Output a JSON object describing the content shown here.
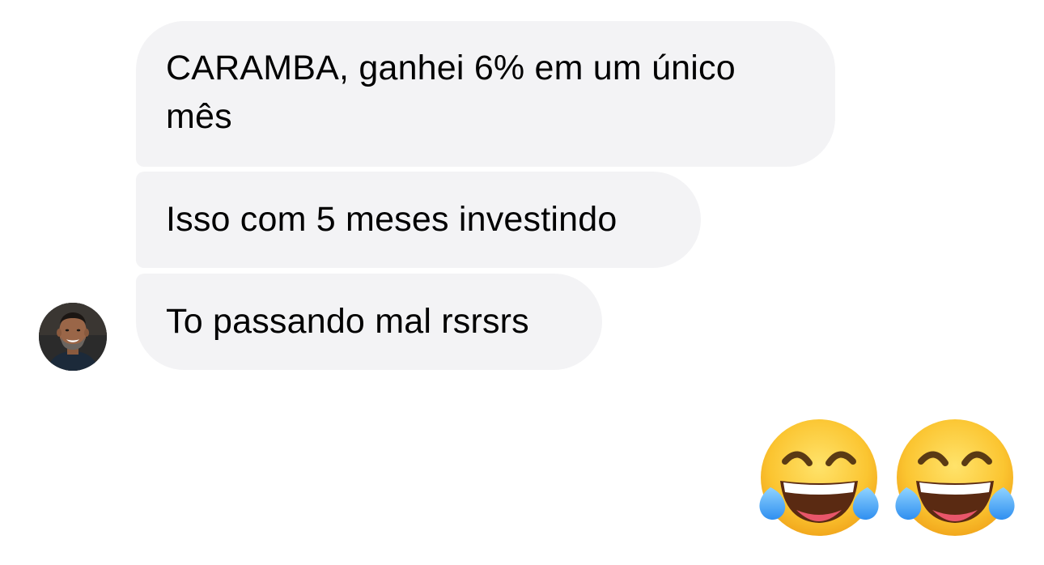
{
  "conversation": {
    "incoming_messages": [
      {
        "text": "CARAMBA, ganhei 6% em um único mês"
      },
      {
        "text": "Isso com 5 meses investindo"
      },
      {
        "text": "To passando mal rsrsrs"
      }
    ],
    "sender": {
      "avatar_icon": "person-photo-avatar"
    },
    "outgoing_emoji": [
      {
        "icon": "face-with-tears-of-joy-icon"
      },
      {
        "icon": "face-with-tears-of-joy-icon"
      }
    ]
  },
  "colors": {
    "incoming_bubble": "#f3f3f5",
    "background": "#ffffff",
    "text": "#000000"
  }
}
